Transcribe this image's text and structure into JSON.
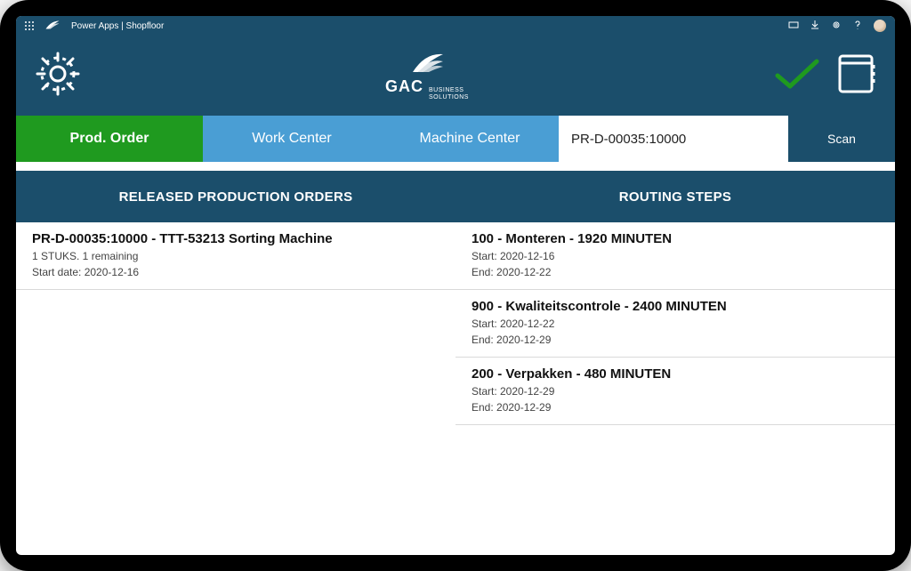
{
  "topbar": {
    "breadcrumb": "Power Apps  |  Shopfloor"
  },
  "brand": {
    "main": "GAC",
    "sub1": "BUSINESS",
    "sub2": "SOLUTIONS"
  },
  "tabs": {
    "prod": "Prod. Order",
    "work": "Work Center",
    "machine": "Machine Center"
  },
  "search": {
    "value": "PR-D-00035:10000"
  },
  "scan_label": "Scan",
  "sections": {
    "left": "RELEASED PRODUCTION ORDERS",
    "right": "ROUTING STEPS"
  },
  "orders": [
    {
      "title": "PR-D-00035:10000 - TTT-53213 Sorting Machine",
      "qty": "1 STUKS. 1 remaining",
      "start": "Start date: 2020-12-16"
    }
  ],
  "steps": [
    {
      "title": "100 - Monteren - 1920 MINUTEN",
      "start": "Start: 2020-12-16",
      "end": "End: 2020-12-22"
    },
    {
      "title": "900 - Kwaliteitscontrole - 2400 MINUTEN",
      "start": "Start: 2020-12-22",
      "end": "End: 2020-12-29"
    },
    {
      "title": "200 - Verpakken - 480 MINUTEN",
      "start": "Start: 2020-12-29",
      "end": "End: 2020-12-29"
    }
  ]
}
